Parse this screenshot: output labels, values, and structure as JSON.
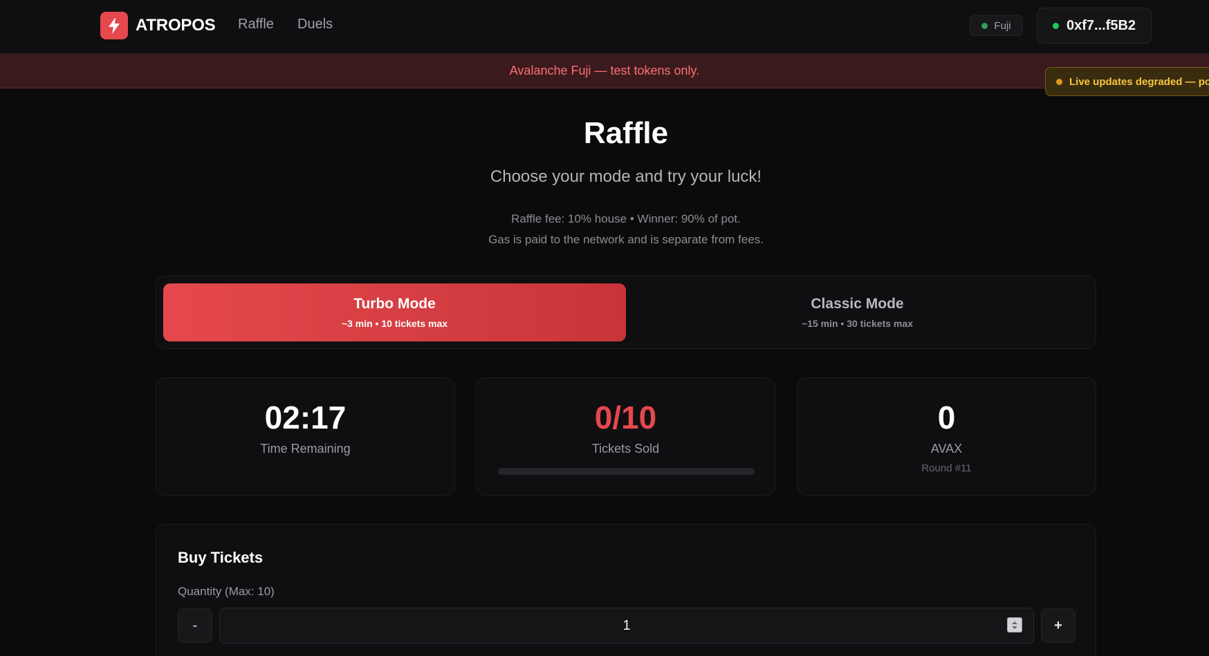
{
  "header": {
    "brand_name": "ATROPOS",
    "brand_icon": "lightning-bolt-icon",
    "nav": [
      "Raffle",
      "Duels"
    ],
    "network_label": "Fuji",
    "wallet_address": "0xf7...f5B2"
  },
  "banner": {
    "network_notice": "Avalanche Fuji — test tokens only.",
    "toast": "Live updates degraded — po"
  },
  "hero": {
    "title": "Raffle",
    "subtitle": "Choose your mode and try your luck!",
    "fee_line": "Raffle fee: 10% house • Winner: 90% of pot.",
    "gas_line": "Gas is paid to the network and is separate from fees."
  },
  "modes": {
    "selected": "turbo",
    "turbo": {
      "title": "Turbo Mode",
      "subtitle": "~3 min • 10 tickets max"
    },
    "classic": {
      "title": "Classic Mode",
      "subtitle": "~15 min • 30 tickets max"
    }
  },
  "stats": {
    "time_remaining": {
      "value": "02:17",
      "label": "Time Remaining"
    },
    "tickets": {
      "value": "0/10",
      "label": "Tickets Sold",
      "progress_fraction": 0
    },
    "pot": {
      "value": "0",
      "label": "AVAX",
      "round": "Round #11"
    }
  },
  "buy": {
    "title": "Buy Tickets",
    "quantity_label": "Quantity (Max: 10)",
    "quantity_value": "1",
    "minus_label": "-",
    "plus_label": "+"
  },
  "colors": {
    "accent": "#e5484d",
    "background": "#0b0b0c",
    "success": "#22c55e",
    "warning": "#f5c542"
  }
}
